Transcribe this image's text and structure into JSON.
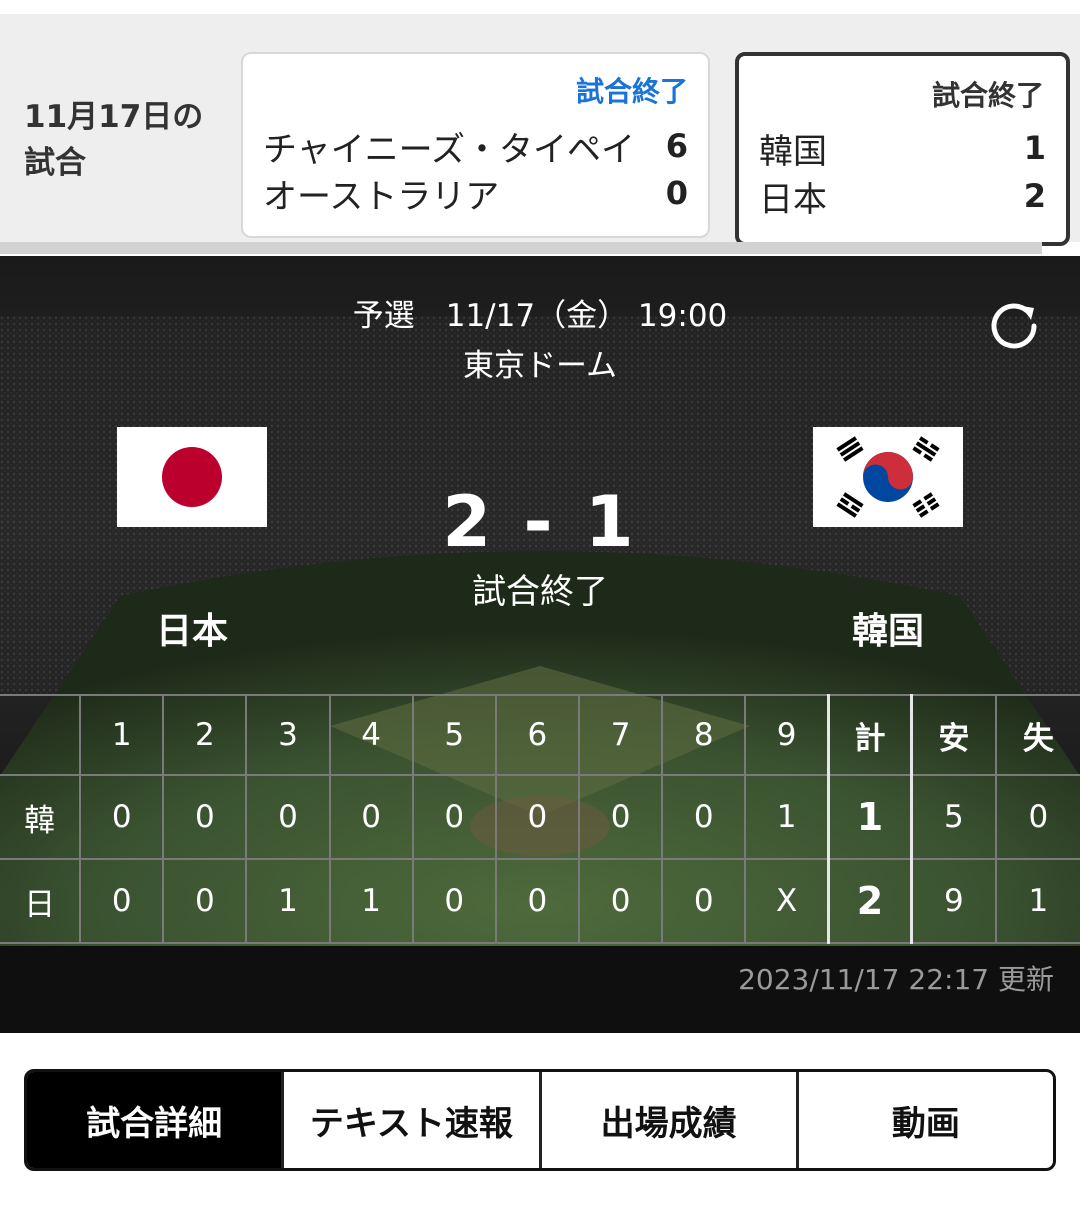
{
  "date_label": "11月17日の試合",
  "games": [
    {
      "status": "試合終了",
      "teams": [
        {
          "name": "チャイニーズ・タイペイ",
          "score": "6"
        },
        {
          "name": "オーストラリア",
          "score": "0"
        }
      ]
    },
    {
      "status": "試合終了",
      "teams": [
        {
          "name": "韓国",
          "score": "1"
        },
        {
          "name": "日本",
          "score": "2"
        }
      ]
    }
  ],
  "match": {
    "info_line": "予選　11/17（金） 19:00",
    "venue": "東京ドーム",
    "home_team": "日本",
    "away_team": "韓国",
    "score_text": "2 - 1",
    "status": "試合終了",
    "updated": "2023/11/17 22:17 更新"
  },
  "line_score": {
    "header": [
      "",
      "1",
      "2",
      "3",
      "4",
      "5",
      "6",
      "7",
      "8",
      "9",
      "計",
      "安",
      "失"
    ],
    "rows": [
      {
        "team": "韓",
        "cells": [
          "0",
          "0",
          "0",
          "0",
          "0",
          "0",
          "0",
          "0",
          "1"
        ],
        "total": "1",
        "hits": "5",
        "errors": "0"
      },
      {
        "team": "日",
        "cells": [
          "0",
          "0",
          "1",
          "1",
          "0",
          "0",
          "0",
          "0",
          "X"
        ],
        "total": "2",
        "hits": "9",
        "errors": "1"
      }
    ]
  },
  "tabs": [
    {
      "label": "試合詳細",
      "active": true
    },
    {
      "label": "テキスト速報",
      "active": false
    },
    {
      "label": "出場成績",
      "active": false
    },
    {
      "label": "動画",
      "active": false
    }
  ],
  "colors": {
    "accent_blue": "#1a73d9",
    "japan_red": "#bc002d",
    "korea_red": "#cd2e3a",
    "korea_blue": "#0047a0"
  }
}
